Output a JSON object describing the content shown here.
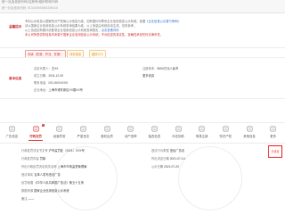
{
  "top": {
    "line1": "统一社会信用代码/注册号/组织机构代码",
    "line2": "统一社会信用代码: 913100005851539416"
  },
  "notice": {
    "label": "温馨提示",
    "line1": "专利公示信息以国家知识产权局公示信息为准，如有疑问可联系企业信用信息公示系统。依据",
    "line1_link": "《企业信息公示暂行条例》",
    "line2": "请以国家企业信用信息公示系统查询结果为准，以上信息由系统自动生成，仅供参考。",
    "line3": "以上信息如有疑问请登录企业信用信息公示系统查询核实，",
    "line3_link": "点击查看详情",
    "line4": "本公司所提供的信息均来源于国家企业信用信息公示系统，不对信息的真实性、准确性承担任何法律责任。"
  },
  "tags": {
    "status_label": "登记状态",
    "tag1": "存续（在营、开业、在册）",
    "tag2": "涉诉信息",
    "tag3": "被执行人"
  },
  "basic": {
    "label": "基本信息",
    "legal_rep_label": "法定代表人：",
    "legal_rep_value": "王XX",
    "reg_capital_label": "注册资本：",
    "reg_capital_value": "5000万元人民币",
    "est_date_label": "成立日期：",
    "est_date_value": "2011-12-20",
    "phone_label": "联系电话：",
    "phone_value": "021-5XXXXXX",
    "address_label": "企业地址：",
    "address_value": "上海市浦东新区XX路XX号",
    "more_label": "更多信息"
  },
  "tabs": [
    {
      "label": "广告信息"
    },
    {
      "label": "行政处罚",
      "badge": "1"
    },
    {
      "label": "经营异常"
    },
    {
      "label": "严重违法"
    },
    {
      "label": "股权出质"
    },
    {
      "label": "动产抵押"
    },
    {
      "label": "抽查检查"
    },
    {
      "label": "司法协助"
    },
    {
      "label": "简易注销"
    },
    {
      "label": "知识产权"
    },
    {
      "label": "其他信息"
    },
    {
      "label": "更多"
    }
  ],
  "penalty": {
    "r1_label": "行政处罚决定书文号",
    "r1_value": "沪市监罚处〔2021〕XXX号",
    "r1b_label": "违法行为类型",
    "r1b_value": "违反广告法",
    "r2_label": "行政处罚内容",
    "r2_value": "罚款",
    "r2b_label": "作出决定日期",
    "r2b_value": "2021-07-14",
    "r3_label": "作出行政处罚决定机关名称",
    "r3_value": "上海市市场监督管理局",
    "r3b_label": "公示日期",
    "r3b_value": "2021-07-20",
    "r4_label": "违法事实",
    "r4_value": "当事人发布违法广告",
    "r5_label": "处罚依据",
    "r5_value": "《中华人民共和国广告法》第五十五条",
    "r6_label": "数据来源",
    "r6_value": "国家企业信用信息公示系统",
    "r7_label": "备注",
    "r7_value": "——"
  },
  "sticker": "已核查"
}
